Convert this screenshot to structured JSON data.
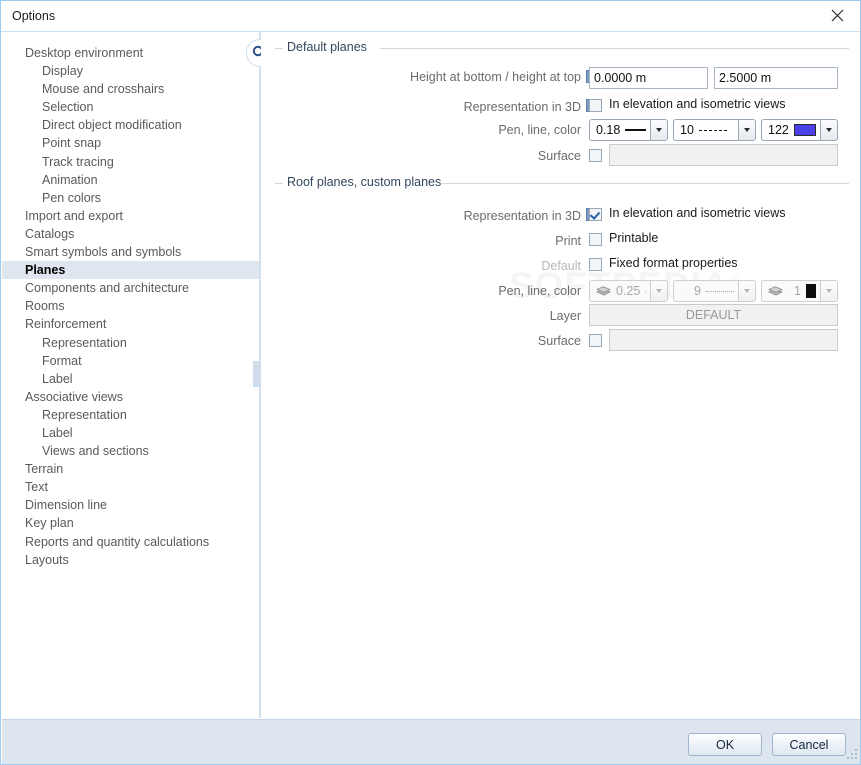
{
  "window": {
    "title": "Options",
    "close_icon": "close-icon"
  },
  "sidebar": {
    "items": [
      {
        "label": "Desktop environment",
        "level": 0,
        "selected": false
      },
      {
        "label": "Display",
        "level": 1,
        "selected": false
      },
      {
        "label": "Mouse and crosshairs",
        "level": 1,
        "selected": false
      },
      {
        "label": "Selection",
        "level": 1,
        "selected": false
      },
      {
        "label": "Direct object modification",
        "level": 1,
        "selected": false
      },
      {
        "label": "Point snap",
        "level": 1,
        "selected": false
      },
      {
        "label": "Track tracing",
        "level": 1,
        "selected": false
      },
      {
        "label": "Animation",
        "level": 1,
        "selected": false
      },
      {
        "label": "Pen colors",
        "level": 1,
        "selected": false
      },
      {
        "label": "Import and export",
        "level": 0,
        "selected": false
      },
      {
        "label": "Catalogs",
        "level": 0,
        "selected": false
      },
      {
        "label": "Smart symbols and symbols",
        "level": 0,
        "selected": false
      },
      {
        "label": "Planes",
        "level": 0,
        "selected": true
      },
      {
        "label": "Components and architecture",
        "level": 0,
        "selected": false
      },
      {
        "label": "Rooms",
        "level": 0,
        "selected": false
      },
      {
        "label": "Reinforcement",
        "level": 0,
        "selected": false
      },
      {
        "label": "Representation",
        "level": 1,
        "selected": false
      },
      {
        "label": "Format",
        "level": 1,
        "selected": false
      },
      {
        "label": "Label",
        "level": 1,
        "selected": false
      },
      {
        "label": "Associative views",
        "level": 0,
        "selected": false
      },
      {
        "label": "Representation",
        "level": 1,
        "selected": false
      },
      {
        "label": "Label",
        "level": 1,
        "selected": false
      },
      {
        "label": "Views and sections",
        "level": 1,
        "selected": false
      },
      {
        "label": "Terrain",
        "level": 0,
        "selected": false
      },
      {
        "label": "Text",
        "level": 0,
        "selected": false
      },
      {
        "label": "Dimension line",
        "level": 0,
        "selected": false
      },
      {
        "label": "Key plan",
        "level": 0,
        "selected": false
      },
      {
        "label": "Reports and quantity calculations",
        "level": 0,
        "selected": false
      },
      {
        "label": "Layouts",
        "level": 0,
        "selected": false
      }
    ],
    "info_icon": "info-icon"
  },
  "content": {
    "watermark": "SOFTPEDIA",
    "key_icon": "key-icon",
    "default_planes": {
      "title": "Default planes",
      "height_label": "Height at bottom / height at top",
      "height_info_icon": "info-icon",
      "height_bottom": "0.0000 m",
      "height_top": "2.5000 m",
      "representation_label": "Representation in 3D",
      "representation_info_icon": "info-icon",
      "representation_checkbox_label": "In elevation and isometric views",
      "representation_checked": false,
      "pen_label": "Pen, line, color",
      "pen_value": "0.18",
      "line_value": "10",
      "color_value": "122",
      "color_swatch": "#4a42e8",
      "surface_label": "Surface",
      "surface_checked": false,
      "surface_value": ""
    },
    "roof_planes": {
      "title": "Roof planes, custom planes",
      "representation_label": "Representation in 3D",
      "representation_info_icon": "info-icon",
      "representation_checkbox_label": "In elevation and isometric views",
      "representation_checked": true,
      "print_label": "Print",
      "print_checkbox_label": "Printable",
      "print_checked": false,
      "default_label": "Default",
      "default_checkbox_label": "Fixed format properties",
      "default_checked": false,
      "pen_label": "Pen, line, color",
      "pen_value": "0.25",
      "line_value": "9",
      "color_value": "1",
      "layer_label": "Layer",
      "layer_value": "DEFAULT",
      "surface_label": "Surface",
      "surface_checked": false,
      "surface_value": ""
    }
  },
  "footer": {
    "ok_label": "OK",
    "cancel_label": "Cancel"
  }
}
